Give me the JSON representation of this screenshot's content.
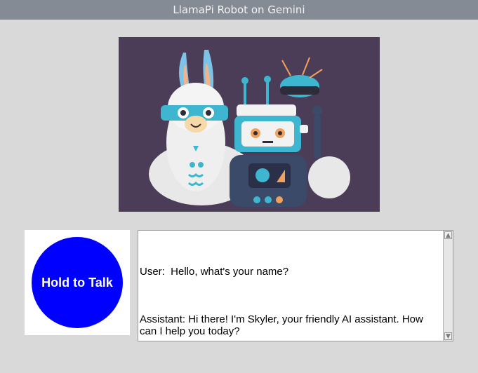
{
  "window": {
    "title": "LlamaPi Robot on Gemini"
  },
  "talk_button": {
    "label": "Hold to Talk"
  },
  "chat": {
    "messages": [
      {
        "text": "User:  Hello, what's your name?"
      },
      {
        "text": "Assistant: Hi there! I'm Skyler, your friendly AI assistant. How can I help you today?"
      }
    ]
  },
  "icons": {
    "scroll_up": "scroll-up-arrow",
    "scroll_down": "scroll-down-arrow"
  },
  "colors": {
    "titlebar": "#858b94",
    "talk_button": "#0000ff",
    "background": "#d9d9d9"
  }
}
